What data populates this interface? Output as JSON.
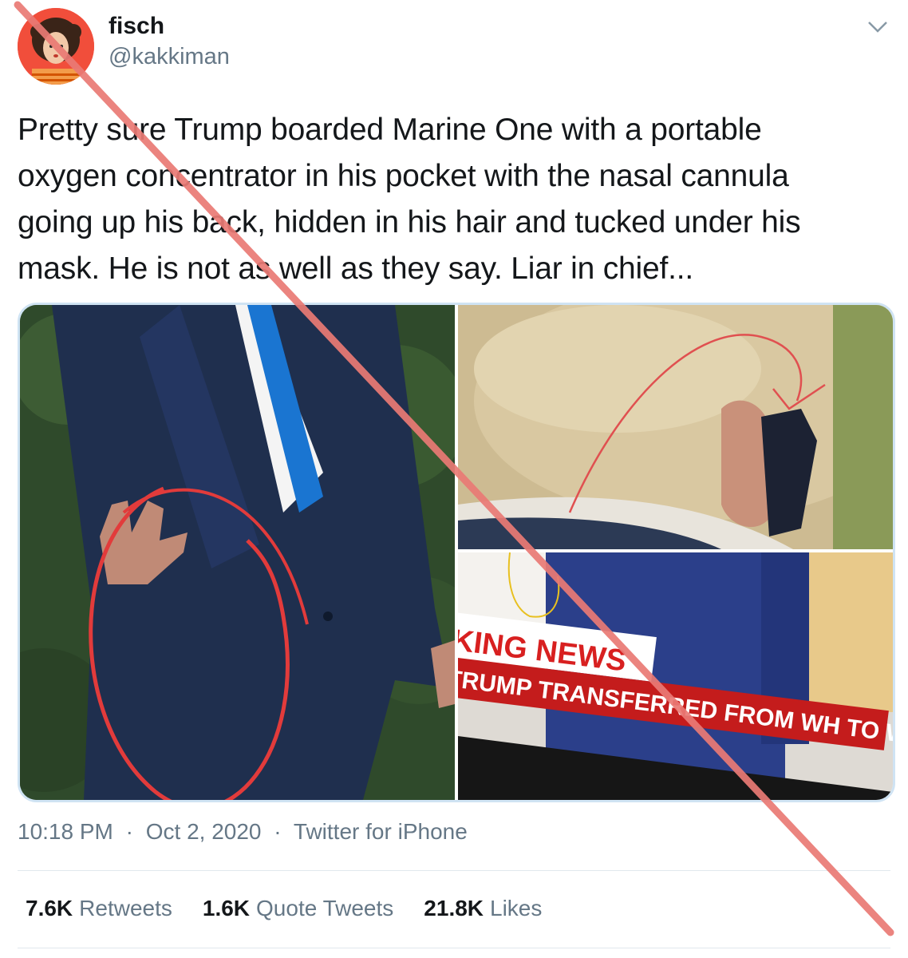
{
  "user": {
    "name": "fisch",
    "handle": "@kakkiman"
  },
  "tweet": {
    "lines": [
      "Pretty sure Trump boarded Marine One with a portable",
      "oxygen concentrator in his pocket with the nasal cannula",
      "going up his back, hidden in his hair and tucked under his",
      "mask. He is not as well as they say. Liar in chief..."
    ],
    "time": "10:18 PM",
    "date": "Oct 2, 2020",
    "source": "Twitter for iPhone",
    "separator": "·"
  },
  "media": {
    "news_banner": "KING NEWS",
    "news_ticker": "TRUMP TRANSFERRED FROM WH TO WALTE"
  },
  "stats": {
    "retweets_count": "7.6K",
    "retweets_label": "Retweets",
    "quotes_count": "1.6K",
    "quotes_label": "Quote Tweets",
    "likes_count": "21.8K",
    "likes_label": "Likes"
  },
  "colors": {
    "strike": "#ea7a75",
    "annotation_red": "#e23b3b",
    "border": "#cfe3f3",
    "muted": "#657786"
  },
  "icons": [
    "chevron-down-icon"
  ]
}
